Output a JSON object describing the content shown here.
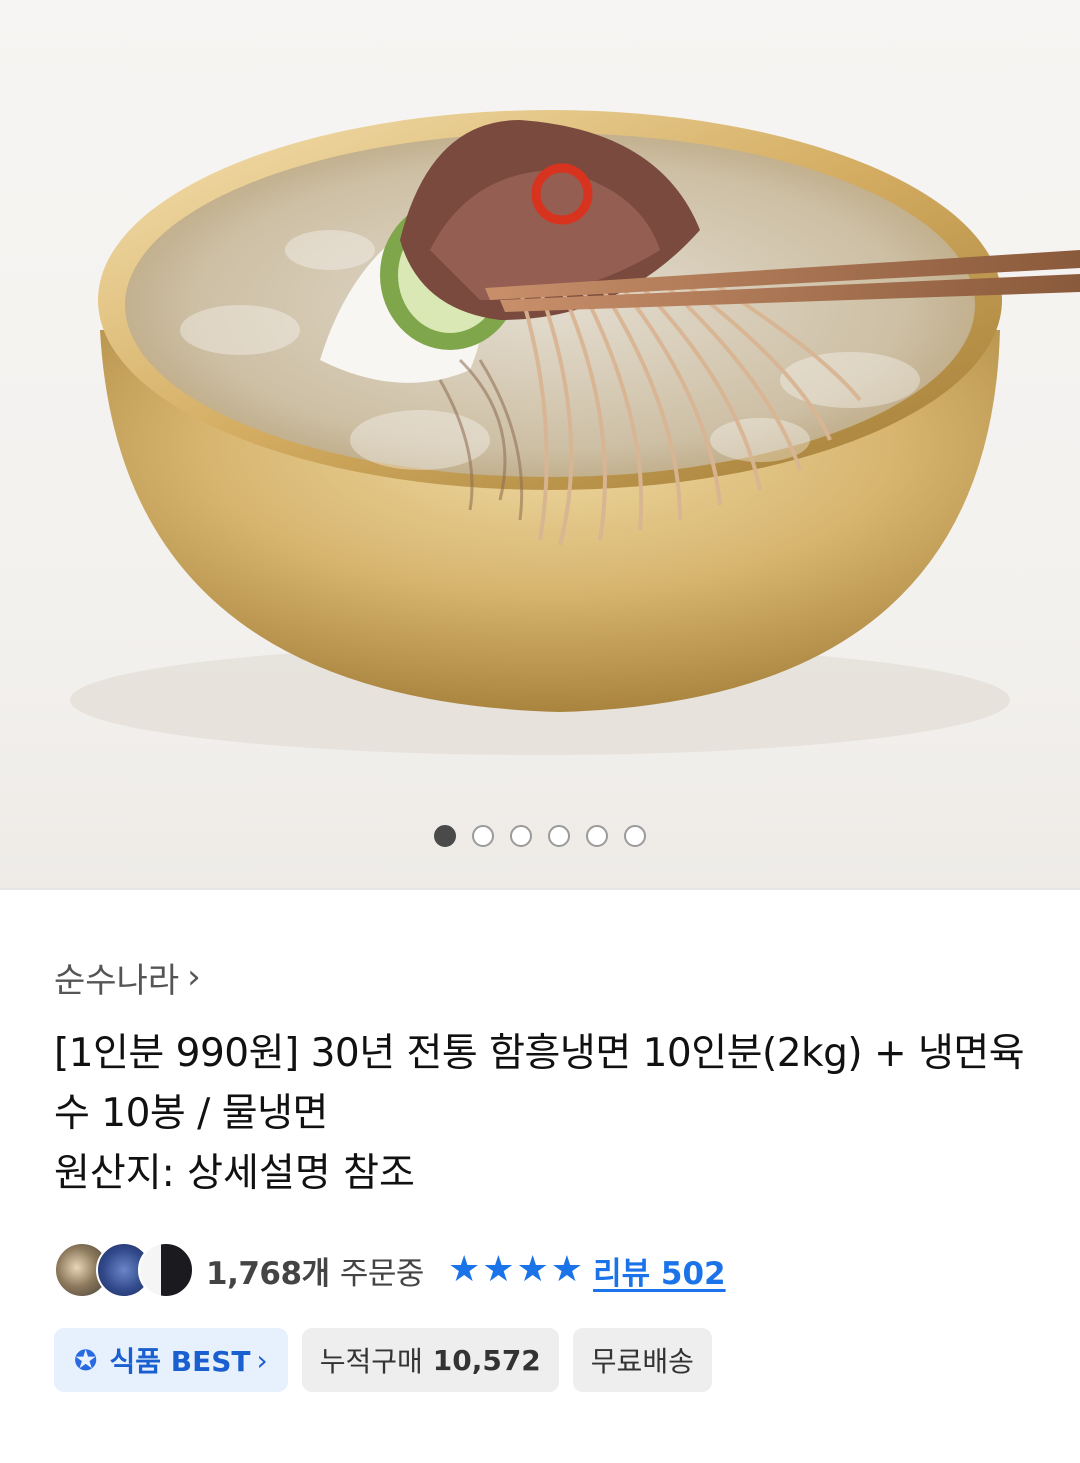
{
  "hero": {
    "image_name": "naengmyeon-bowl-photo",
    "carousel": {
      "total": 6,
      "active_index": 0
    }
  },
  "product": {
    "seller": "순수나라",
    "title": "[1인분 990원] 30년 전통 함흥냉면 10인분(2kg) + 냉면육수 10봉 / 물냉면",
    "origin": "원산지: 상세설명 참조",
    "orders_count": "1,768개",
    "orders_suffix": "주문중",
    "rating_stars": 4,
    "reviews_label": "리뷰 502"
  },
  "badges": {
    "best_label": "식품 BEST",
    "cumulative_label": "누적구매",
    "cumulative_value": "10,572",
    "shipping_label": "무료배송"
  },
  "colors": {
    "accent_blue": "#1a73e8",
    "best_badge_bg": "#e7f0fd",
    "neutral_badge_bg": "#eeeeee"
  }
}
